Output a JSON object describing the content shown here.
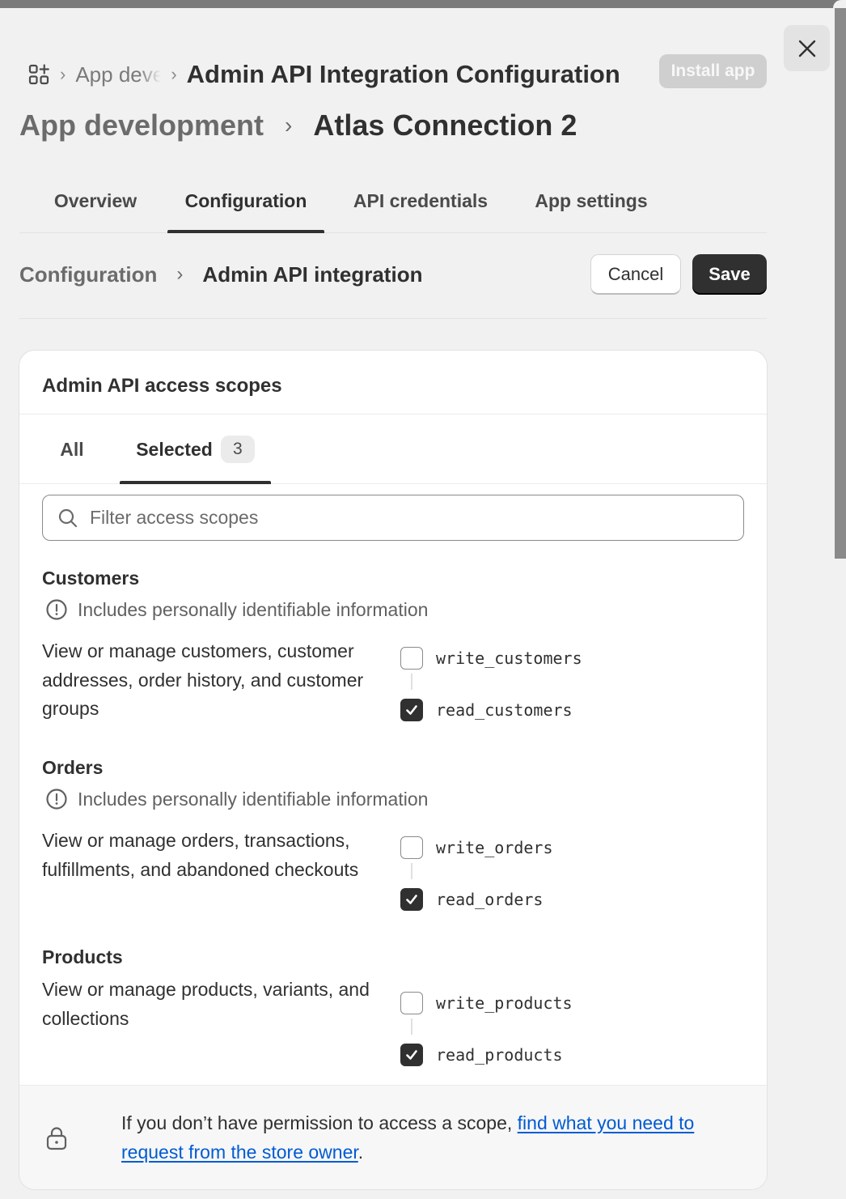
{
  "header": {
    "breadcrumb": {
      "previous": "App development",
      "current": "Admin API Integration Configuration"
    },
    "install_label": "Install app",
    "title_parent": "App development",
    "title_current": "Atlas Connection 2"
  },
  "tabs": [
    {
      "label": "Overview"
    },
    {
      "label": "Configuration",
      "active": true
    },
    {
      "label": "API credentials"
    },
    {
      "label": "App settings"
    }
  ],
  "subheader": {
    "parent": "Configuration",
    "current": "Admin API integration",
    "cancel_label": "Cancel",
    "save_label": "Save"
  },
  "card": {
    "title": "Admin API access scopes",
    "tabs": {
      "all": "All",
      "selected": "Selected",
      "selected_count": "3"
    },
    "search": {
      "placeholder": "Filter access scopes",
      "value": ""
    },
    "sections": [
      {
        "title": "Customers",
        "pii": "Includes personally identifiable information",
        "description": "View or manage customers, customer addresses, order history, and customer groups",
        "scopes": [
          {
            "name": "write_customers",
            "checked": false
          },
          {
            "name": "read_customers",
            "checked": true
          }
        ]
      },
      {
        "title": "Orders",
        "pii": "Includes personally identifiable information",
        "description": "View or manage orders, transactions, fulfillments, and abandoned checkouts",
        "scopes": [
          {
            "name": "write_orders",
            "checked": false
          },
          {
            "name": "read_orders",
            "checked": true
          }
        ]
      },
      {
        "title": "Products",
        "description": "View or manage products, variants, and collections",
        "scopes": [
          {
            "name": "write_products",
            "checked": false
          },
          {
            "name": "read_products",
            "checked": true
          }
        ]
      }
    ],
    "footer": {
      "text": "If you don’t have permission to access a scope, ",
      "link": "find what you need to request from the store owner",
      "end": "."
    }
  },
  "colors": {
    "primary": "#303030",
    "link": "#005bd3",
    "disabled_button": "#cfcfcf",
    "page_background": "#f1f1f1"
  },
  "icons": [
    "app-grid-icon",
    "close-icon",
    "search-icon",
    "alert-circle-icon",
    "checkmark-icon",
    "lock-icon"
  ]
}
